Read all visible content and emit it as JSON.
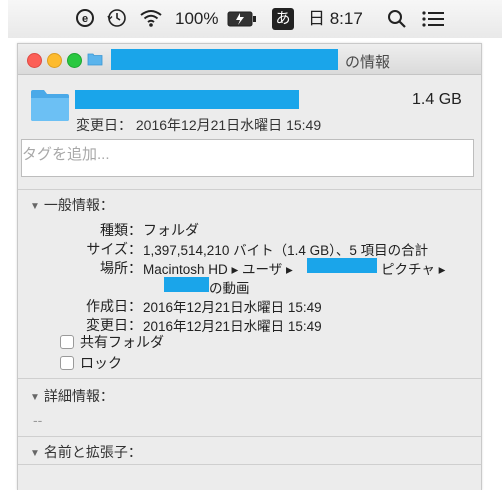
{
  "menubar": {
    "battery": "100%",
    "ime": "あ",
    "clock": "日 8:17"
  },
  "window": {
    "title_suffix": "の情報",
    "size": "1.4 GB",
    "modified_header": "変更日： 2016年12月21日水曜日 15:49",
    "tags_placeholder": "タグを追加...",
    "general": {
      "header": "一般情報：",
      "kind_label": "種類：",
      "kind_value": "フォルダ",
      "size_label": "サイズ：",
      "size_value": "1,397,514,210 バイト（1.4 GB）、5 項目の合計",
      "where_label": "場所：",
      "where_value_1": "Macintosh HD ▸ ユーザ ▸",
      "where_value_2": "ピクチャ ▸",
      "where_value_3": "の動画",
      "created_label": "作成日：",
      "created_value": "2016年12月21日水曜日 15:49",
      "modified_label": "変更日：",
      "modified_value": "2016年12月21日水曜日 15:49",
      "shared_folder": "共有フォルダ",
      "locked": "ロック"
    },
    "more_info": {
      "header": "詳細情報：",
      "value": "--"
    },
    "name_ext": {
      "header": "名前と拡張子："
    }
  },
  "colors": {
    "redaction": "#1aa5ea",
    "folder": "#5bb4ec",
    "close": "#fc5f57",
    "minimize": "#fdbb2e",
    "zoom": "#2ac840"
  }
}
